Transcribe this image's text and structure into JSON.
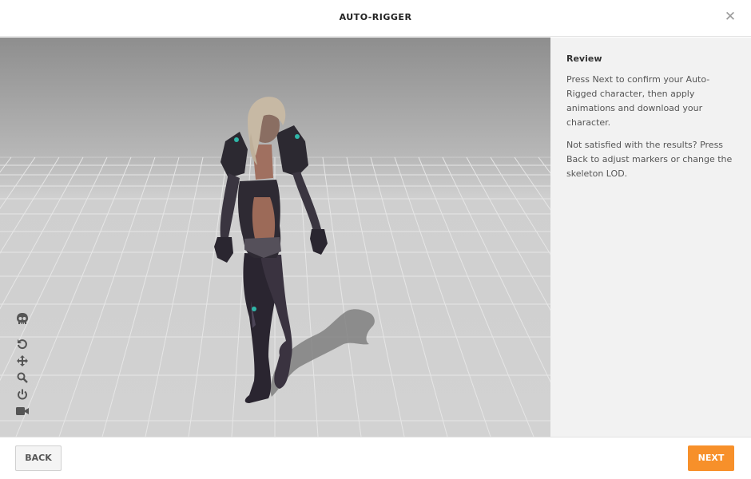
{
  "window": {
    "title": "AUTO-RIGGER",
    "close_icon": "close-icon"
  },
  "viewport": {
    "tools": [
      {
        "name": "skeleton-icon"
      },
      {
        "name": "reset-view-icon"
      },
      {
        "name": "pan-icon"
      },
      {
        "name": "zoom-icon"
      },
      {
        "name": "power-icon"
      },
      {
        "name": "camera-icon"
      }
    ]
  },
  "review": {
    "heading": "Review",
    "paragraph1": "Press Next to confirm your Auto-Rigged character, then apply animations and download your character.",
    "paragraph2": "Not satisfied with the results? Press Back to adjust markers or change the skeleton LOD."
  },
  "footer": {
    "back_label": "BACK",
    "next_label": "NEXT"
  },
  "colors": {
    "accent": "#f7902a",
    "panel_bg": "#f2f2f2",
    "floor": "#d2d2d2"
  }
}
